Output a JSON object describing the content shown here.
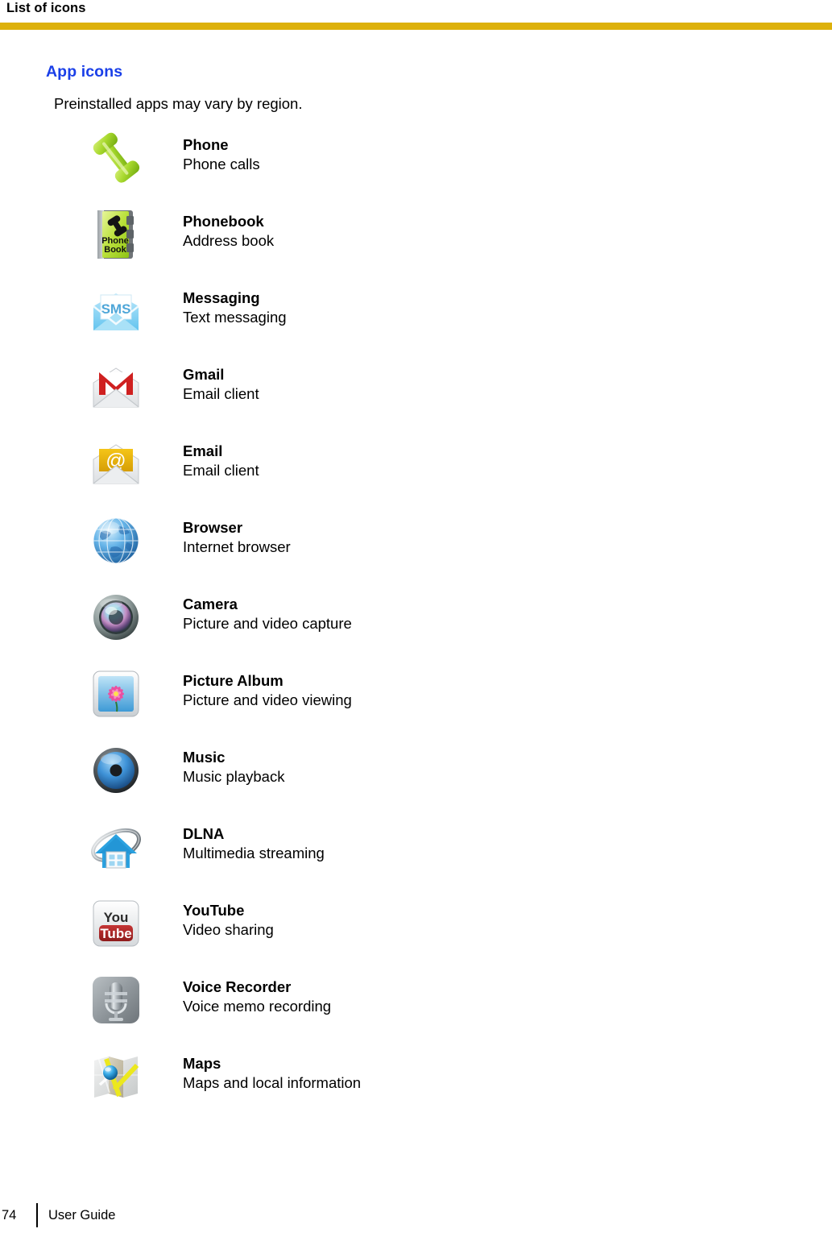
{
  "header": {
    "title": "List of icons",
    "rule_color": "#ddb10b"
  },
  "section": {
    "heading": "App icons",
    "heading_color": "#1a3fe8",
    "note": "Preinstalled apps may vary by region."
  },
  "apps": [
    {
      "icon": "phone-handset-icon",
      "name": "Phone",
      "description": "Phone calls"
    },
    {
      "icon": "phonebook-icon",
      "name": "Phonebook",
      "description": "Address book"
    },
    {
      "icon": "sms-envelope-icon",
      "name": "Messaging",
      "description": "Text messaging"
    },
    {
      "icon": "gmail-envelope-icon",
      "name": "Gmail",
      "description": "Email client"
    },
    {
      "icon": "email-envelope-icon",
      "name": "Email",
      "description": "Email client"
    },
    {
      "icon": "globe-browser-icon",
      "name": "Browser",
      "description": "Internet browser"
    },
    {
      "icon": "camera-lens-icon",
      "name": "Camera",
      "description": "Picture and video capture"
    },
    {
      "icon": "picture-album-icon",
      "name": "Picture Album",
      "description": "Picture and video viewing"
    },
    {
      "icon": "music-speaker-icon",
      "name": "Music",
      "description": "Music playback"
    },
    {
      "icon": "dlna-house-icon",
      "name": "DLNA",
      "description": "Multimedia streaming"
    },
    {
      "icon": "youtube-icon",
      "name": "YouTube",
      "description": "Video sharing"
    },
    {
      "icon": "voice-recorder-icon",
      "name": "Voice Recorder",
      "description": "Voice memo recording"
    },
    {
      "icon": "maps-icon",
      "name": "Maps",
      "description": "Maps and local information"
    }
  ],
  "icon_labels": {
    "phonebook_line1": "Phone",
    "phonebook_line2": "Book",
    "sms_text": "SMS",
    "email_at": "@",
    "youtube_line1": "You",
    "youtube_line2": "Tube"
  },
  "footer": {
    "page_number": "74",
    "label": "User Guide"
  }
}
